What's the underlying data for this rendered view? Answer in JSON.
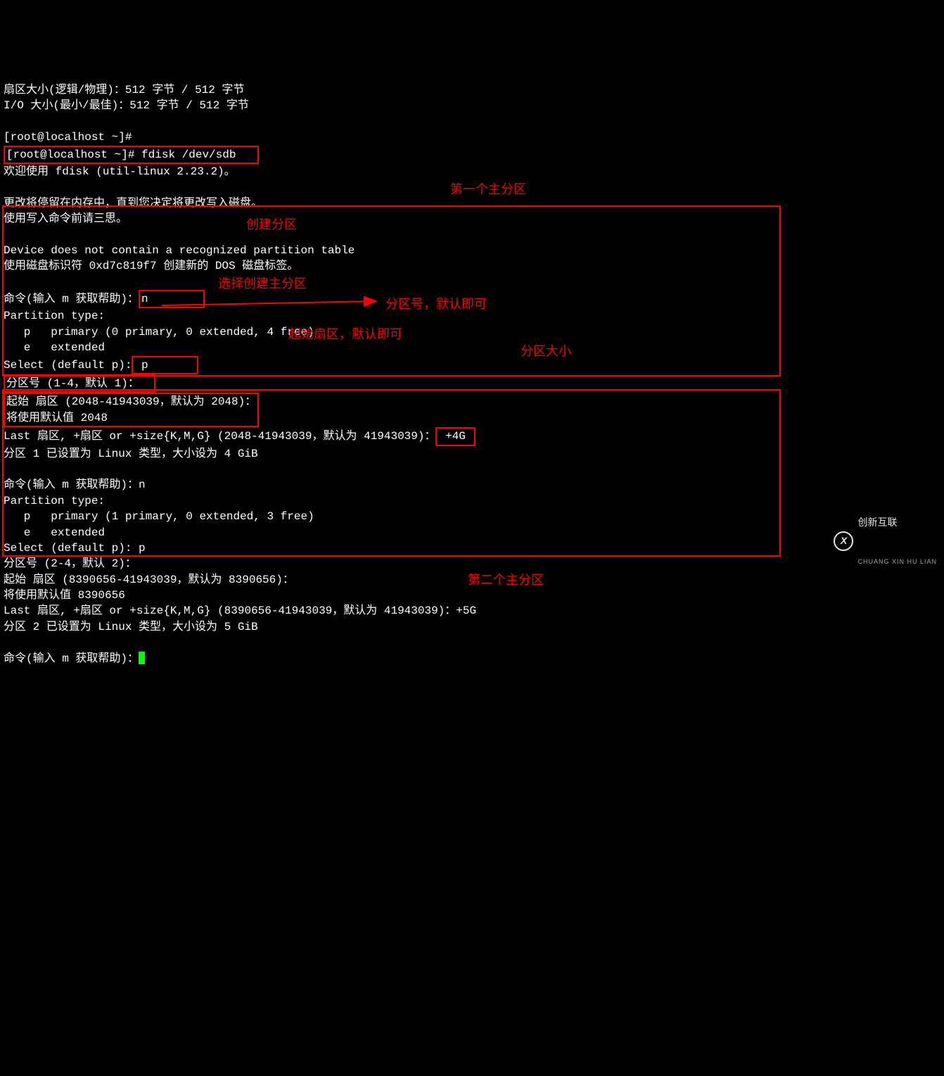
{
  "header": {
    "sector_size_line": "扇区大小(逻辑/物理)：512 字节 / 512 字节",
    "io_size_line": "I/O 大小(最小/最佳)：512 字节 / 512 字节",
    "prompt1": "[root@localhost ~]#",
    "prompt2": "[root@localhost ~]# fdisk /dev/sdb",
    "welcome": "欢迎使用 fdisk (util-linux 2.23.2)。",
    "changes_note1": "更改将停留在内存中，直到您决定将更改写入磁盘。",
    "changes_note2": "使用写入命令前请三思。",
    "device_no_table": "Device does not contain a recognized partition table",
    "disk_id_line": "使用磁盘标识符 0xd7c819f7 创建新的 DOS 磁盘标签。"
  },
  "partition1": {
    "cmd_prompt": "命令(输入 m 获取帮助)：",
    "cmd_input": "n",
    "partition_type_label": "Partition type:",
    "primary_line": "   p   primary (0 primary, 0 extended, 4 free)",
    "extended_line": "   e   extended",
    "select_prompt": "Select (default p):",
    "select_input": " p",
    "part_num_prompt": "分区号 (1-4，默认 1)：",
    "start_sector_prompt": "起始 扇区 (2048-41943039，默认为 2048)：",
    "default_value_line": "将使用默认值 2048",
    "last_sector_prompt": "Last 扇区, +扇区 or +size{K,M,G} (2048-41943039，默认为 41943039)：",
    "size_input": "+4G",
    "result_line": "分区 1 已设置为 Linux 类型，大小设为 4 GiB"
  },
  "partition2": {
    "cmd_prompt": "命令(输入 m 获取帮助)：n",
    "partition_type_label": "Partition type:",
    "primary_line": "   p   primary (1 primary, 0 extended, 3 free)",
    "extended_line": "   e   extended",
    "select_line": "Select (default p): p",
    "part_num_prompt": "分区号 (2-4，默认 2)：",
    "start_sector_prompt": "起始 扇区 (8390656-41943039，默认为 8390656)：",
    "default_value_line": "将使用默认值 8390656",
    "last_sector_line": "Last 扇区, +扇区 or +size{K,M,G} (8390656-41943039，默认为 41943039)：+5G",
    "result_line": "分区 2 已设置为 Linux 类型，大小设为 5 GiB"
  },
  "final_prompt": "命令(输入 m 获取帮助)：",
  "annotations": {
    "first_partition": "第一个主分区",
    "create_partition": "创建分区",
    "select_primary": "选择创建主分区",
    "partition_number": "分区号，默认即可",
    "start_sector": "起始扇区，默认即可",
    "partition_size": "分区大小",
    "second_partition": "第二个主分区"
  },
  "watermark": {
    "logo_letter": "X",
    "main": "创新互联",
    "sub": "CHUANG XIN HU LIAN"
  }
}
